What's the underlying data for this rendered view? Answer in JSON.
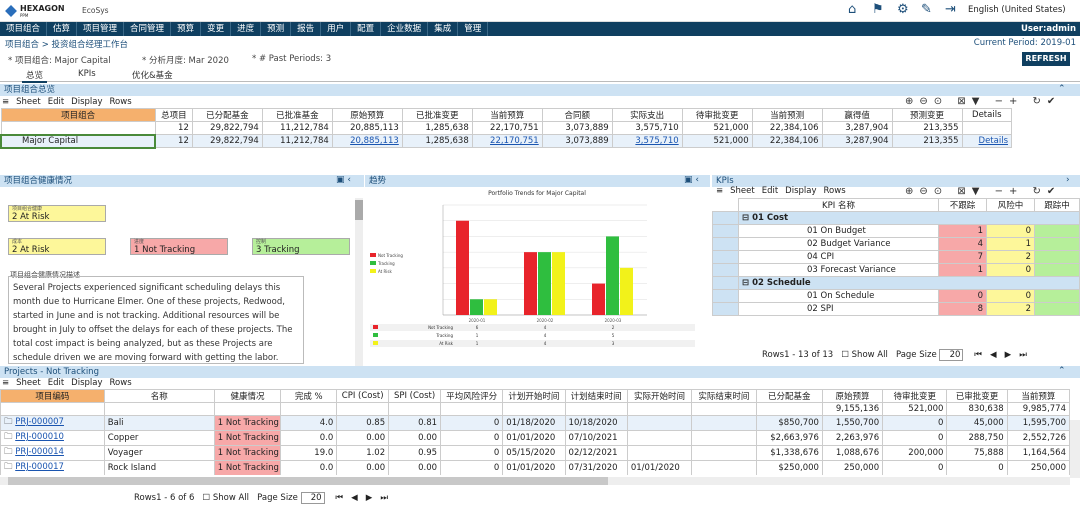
{
  "header": {
    "logo": "HEXAGON",
    "logo_sub": "PPM",
    "product": "EcoSys",
    "language": "English (United States)"
  },
  "menu": [
    "项目组合",
    "估算",
    "项目管理",
    "合同管理",
    "预算",
    "变更",
    "进度",
    "预测",
    "报告",
    "用户",
    "配置",
    "企业数据",
    "集成",
    "管理"
  ],
  "user": "User:admin",
  "breadcrumb": "项目组合 > 投资组合经理工作台",
  "current_period": "Current Period: 2019-01",
  "filters": {
    "portfolio": "* 项目组合: Major Capital",
    "month": "* 分析月度: Mar 2020",
    "past": "* # Past Periods: 3"
  },
  "refresh": "REFRESH",
  "tabs": [
    "总览",
    "KPIs",
    "优化&基金"
  ],
  "summary": {
    "title": "项目组合总览",
    "toolbar": [
      "Sheet",
      "Edit",
      "Display",
      "Rows"
    ],
    "headers": [
      "项目组合",
      "总项目",
      "已分配基金",
      "已批准基金",
      "原始预算",
      "已批准变更",
      "当前预算",
      "合同额",
      "实际支出",
      "待审批变更",
      "当前预测",
      "赢得值",
      "预测变更",
      "Details"
    ],
    "totals": [
      "",
      "12",
      "29,822,794",
      "11,212,784",
      "20,885,113",
      "1,285,638",
      "22,170,751",
      "3,073,889",
      "3,575,710",
      "521,000",
      "22,384,106",
      "3,287,904",
      "213,355",
      ""
    ],
    "row": [
      "Major Capital",
      "12",
      "29,822,794",
      "11,212,784",
      "20,885,113",
      "1,285,638",
      "22,170,751",
      "3,073,889",
      "3,575,710",
      "521,000",
      "22,384,106",
      "3,287,904",
      "213,355",
      "Details"
    ]
  },
  "health": {
    "title": "项目组合健康情况",
    "overall_label": "项目组合健康",
    "overall": "2 At Risk",
    "cost_label": "成本",
    "cost": "2 At Risk",
    "schedule_label": "进度",
    "schedule": "1 Not Tracking",
    "control_label": "控制",
    "control": "3 Tracking",
    "desc_label": "项目组合健康情况描述",
    "desc": "Several Projects experienced significant scheduling delays this month due to Hurricane Elmer.  One of these projects, Redwood, started in June and is not tracking.  Additional resources will be brought in July to offset the delays for each of these projects.  The total cost impact is being analyzed, but as these Projects are schedule driven we are moving forward with getting the labor."
  },
  "trend": {
    "title": "趋势"
  },
  "chart_data": {
    "type": "bar",
    "title": "Portfolio Trends for Major Capital",
    "categories": [
      "2020-01",
      "2020-02",
      "2020-03"
    ],
    "series": [
      {
        "name": "Not Tracking",
        "color": "#e8242b",
        "values": [
          6,
          4,
          2
        ]
      },
      {
        "name": "Tracking",
        "color": "#2fbe3f",
        "values": [
          1,
          4,
          5
        ]
      },
      {
        "name": "At Risk",
        "color": "#f2f21a",
        "values": [
          1,
          4,
          3
        ]
      }
    ],
    "ylim": [
      0,
      7
    ]
  },
  "kpis": {
    "title": "KPIs",
    "toolbar": [
      "Sheet",
      "Edit",
      "Display",
      "Rows"
    ],
    "headers": [
      "KPI 名称",
      "不跟踪",
      "风险中",
      "跟踪中"
    ],
    "groups": [
      {
        "name": "01 Cost",
        "rows": [
          [
            "01 On Budget",
            "1",
            "0"
          ],
          [
            "02 Budget Variance",
            "4",
            "1"
          ],
          [
            "04 CPI",
            "7",
            "2"
          ],
          [
            "03 Forecast Variance",
            "1",
            "0"
          ]
        ]
      },
      {
        "name": "02 Schedule",
        "rows": [
          [
            "01 On Schedule",
            "0",
            "0"
          ],
          [
            "02 SPI",
            "8",
            "2"
          ]
        ]
      }
    ],
    "rows_info": "Rows1 - 13 of 13",
    "show_all": "Show All",
    "page_size_label": "Page Size",
    "page_size": "20"
  },
  "projects": {
    "title": "Projects - Not Tracking",
    "toolbar": [
      "Sheet",
      "Edit",
      "Display",
      "Rows"
    ],
    "headers": [
      "项目编码",
      "名称",
      "健康情况",
      "完成 %",
      "CPI (Cost)",
      "SPI (Cost)",
      "平均风险评分",
      "计划开始时间",
      "计划结束时间",
      "实际开始时间",
      "实际结束时间",
      "已分配基金",
      "原始预算",
      "待审批变更",
      "已审批变更",
      "当前预算"
    ],
    "totals": [
      "",
      "",
      "",
      "",
      "",
      "",
      "",
      "",
      "",
      "",
      "",
      "",
      "9,155,136",
      "521,000",
      "830,638",
      "9,985,774"
    ],
    "rows": [
      [
        "PRJ-000007",
        "Bali",
        "1 Not Tracking",
        "4.0",
        "0.85",
        "0.81",
        "0",
        "01/18/2020",
        "10/18/2020",
        "",
        "",
        "$850,700",
        "1,550,700",
        "0",
        "45,000",
        "1,595,700"
      ],
      [
        "PRJ-000010",
        "Copper",
        "1 Not Tracking",
        "0.0",
        "0.00",
        "0.00",
        "0",
        "01/01/2020",
        "07/10/2021",
        "",
        "",
        "$2,663,976",
        "2,263,976",
        "0",
        "288,750",
        "2,552,726"
      ],
      [
        "PRJ-000014",
        "Voyager",
        "1 Not Tracking",
        "19.0",
        "1.02",
        "0.95",
        "0",
        "05/15/2020",
        "02/12/2021",
        "",
        "",
        "$1,338,676",
        "1,088,676",
        "200,000",
        "75,888",
        "1,164,564"
      ],
      [
        "PRJ-000017",
        "Rock Island",
        "1 Not Tracking",
        "0.0",
        "0.00",
        "0.00",
        "0",
        "01/01/2020",
        "07/31/2020",
        "01/01/2020",
        "",
        "$250,000",
        "250,000",
        "0",
        "0",
        "250,000"
      ]
    ],
    "rows_info": "Rows1 - 6 of 6",
    "show_all": "Show All",
    "page_size_label": "Page Size",
    "page_size": "20"
  }
}
